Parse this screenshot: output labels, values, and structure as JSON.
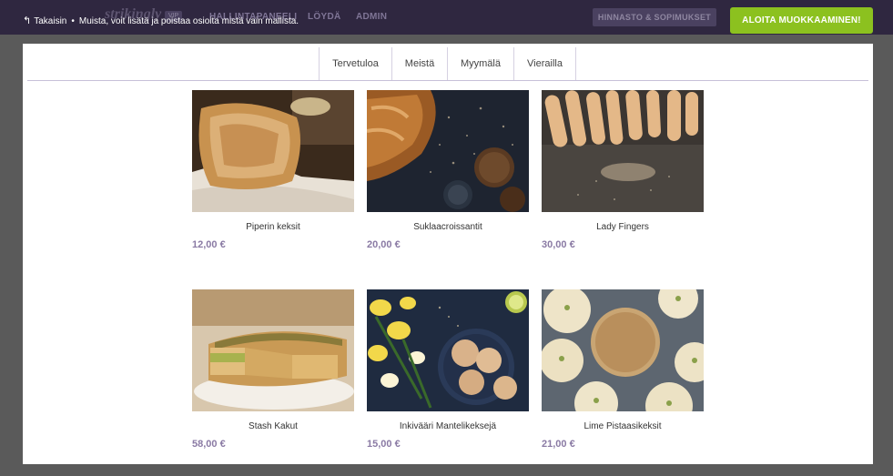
{
  "topbar": {
    "back_label": "Takaisin",
    "separator": "•",
    "notice": "Muista, voit lisätä ja poistaa osioita mistä vain mallista.",
    "logo": "strikingly",
    "vip": "VIP",
    "nav": [
      "HALLINTAPANEELI",
      "LÖYDÄ",
      "ADMIN"
    ],
    "pricing_button": "HINNASTO & SOPIMUKSET",
    "start_button": "ALOITA MUOKKAAMINEN!"
  },
  "site_nav": {
    "tabs": [
      "Tervetuloa",
      "Meistä",
      "Myymälä",
      "Vierailla"
    ]
  },
  "products": [
    {
      "name": "Piperin keksit",
      "price": "12,00 €",
      "image": "bread-loaf-photo"
    },
    {
      "name": "Suklaacroissantit",
      "price": "20,00 €",
      "image": "croissant-photo"
    },
    {
      "name": "Lady Fingers",
      "price": "30,00 €",
      "image": "lady-fingers-photo"
    },
    {
      "name": "Stash Kakut",
      "price": "58,00 €",
      "image": "quiche-photo"
    },
    {
      "name": "Inkivääri Mantelikeksejä",
      "price": "15,00 €",
      "image": "almond-cookies-photo"
    },
    {
      "name": "Lime Pistaasikeksit",
      "price": "21,00 €",
      "image": "pistachio-cookies-photo"
    }
  ],
  "colors": {
    "topbar": "#2f2740",
    "accent_green": "#8cc11f",
    "price": "#8a7aa4",
    "backdrop": "#5a5a5a"
  }
}
